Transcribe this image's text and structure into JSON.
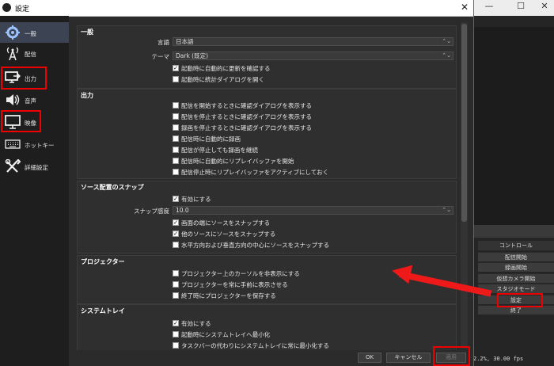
{
  "window": {
    "title": "設定",
    "close_glyph": "✕"
  },
  "bg_window": {
    "minimize_glyph": "—",
    "maximize_glyph": "☐",
    "close_glyph": "✕"
  },
  "sidebar": {
    "items": [
      {
        "label": "一般",
        "icon": "gear-icon"
      },
      {
        "label": "配信",
        "icon": "broadcast-tower-icon"
      },
      {
        "label": "出力",
        "icon": "output-icon"
      },
      {
        "label": "音声",
        "icon": "speaker-icon"
      },
      {
        "label": "映像",
        "icon": "monitor-icon"
      },
      {
        "label": "ホットキー",
        "icon": "keyboard-icon"
      },
      {
        "label": "詳細設定",
        "icon": "tools-icon"
      }
    ]
  },
  "general": {
    "title": "一般",
    "language_label": "言語",
    "language_value": "日本語",
    "theme_label": "テーマ",
    "theme_value": "Dark (既定)",
    "check_update": "起動時に自動的に更新を確認する",
    "open_stats": "起動時に統計ダイアログを開く"
  },
  "output": {
    "title": "出力",
    "items": [
      {
        "label": "配信を開始するときに確認ダイアログを表示する",
        "checked": false
      },
      {
        "label": "配信を停止するときに確認ダイアログを表示する",
        "checked": false
      },
      {
        "label": "録画を停止するときに確認ダイアログを表示する",
        "checked": false
      },
      {
        "label": "配信時に自動的に録画",
        "checked": false
      },
      {
        "label": "配信が停止しても録画を継続",
        "checked": false
      },
      {
        "label": "配信時に自動的にリプレイバッファを開始",
        "checked": false
      },
      {
        "label": "配信停止時にリプレイバッファをアクティブにしておく",
        "checked": false
      }
    ]
  },
  "snap": {
    "title": "ソース配置のスナップ",
    "enable": "有効にする",
    "sensitivity_label": "スナップ感度",
    "sensitivity_value": "10.0",
    "items": [
      {
        "label": "画面の端にソースをスナップする",
        "checked": true
      },
      {
        "label": "他のソースにソースをスナップする",
        "checked": true
      },
      {
        "label": "水平方向および垂直方向の中心にソースをスナップする",
        "checked": false
      }
    ]
  },
  "projector": {
    "title": "プロジェクター",
    "items": [
      {
        "label": "プロジェクター上のカーソルを非表示にする",
        "checked": false
      },
      {
        "label": "プロジェクターを常に手前に表示させる",
        "checked": false
      },
      {
        "label": "終了時にプロジェクターを保存する",
        "checked": false
      }
    ]
  },
  "tray": {
    "title": "システムトレイ",
    "items": [
      {
        "label": "有効にする",
        "checked": true
      },
      {
        "label": "起動時にシステムトレイへ最小化",
        "checked": false
      },
      {
        "label": "タスクバーの代わりにシステムトレイに常に最小化する",
        "checked": false
      }
    ]
  },
  "buttons": {
    "ok": "OK",
    "cancel": "キャンセル",
    "apply": "適用"
  },
  "controls": {
    "header": "コントロール",
    "items": [
      "配信開始",
      "録画開始",
      "仮想カメラ開始",
      "スタジオモード",
      "設定",
      "終了"
    ]
  },
  "status": "2.2%, 30.00 fps",
  "check_glyph": "✓",
  "colors": {
    "accent_red": "#ee1a1a",
    "selected": "#3c4453"
  }
}
